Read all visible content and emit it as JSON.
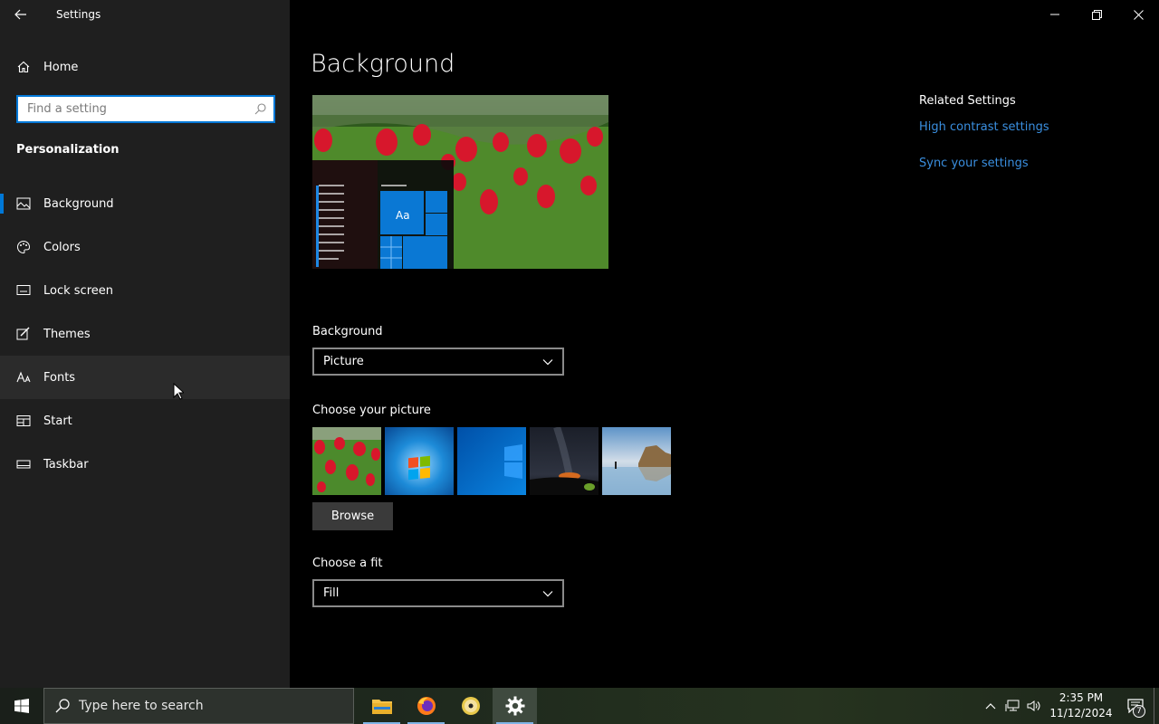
{
  "window": {
    "title": "Settings"
  },
  "sidebar": {
    "home_label": "Home",
    "search_placeholder": "Find a setting",
    "section_title": "Personalization",
    "items": [
      {
        "label": "Background",
        "icon": "picture-icon",
        "selected": true
      },
      {
        "label": "Colors",
        "icon": "palette-icon"
      },
      {
        "label": "Lock screen",
        "icon": "lock-screen-icon"
      },
      {
        "label": "Themes",
        "icon": "themes-brush-icon"
      },
      {
        "label": "Fonts",
        "icon": "fonts-icon",
        "hovered": true
      },
      {
        "label": "Start",
        "icon": "start-menu-icon"
      },
      {
        "label": "Taskbar",
        "icon": "taskbar-icon"
      }
    ]
  },
  "main": {
    "title": "Background",
    "preview_tile_text": "Aa",
    "background_label": "Background",
    "background_value": "Picture",
    "choose_picture_label": "Choose your picture",
    "thumbnails": [
      "tulips",
      "windows-7-logo",
      "windows-10-blue",
      "night-sky",
      "beach-rocks"
    ],
    "browse_label": "Browse",
    "fit_label": "Choose a fit",
    "fit_value": "Fill"
  },
  "related": {
    "title": "Related Settings",
    "links": [
      "High contrast settings",
      "Sync your settings"
    ]
  },
  "taskbar": {
    "search_placeholder": "Type here to search",
    "apps": [
      "file-explorer-icon",
      "firefox-icon",
      "media-disc-icon",
      "settings-gear-icon"
    ],
    "time": "2:35 PM",
    "date": "11/12/2024",
    "notification_count": "7"
  },
  "colors": {
    "accent": "#0078d7",
    "link": "#3a8fe0",
    "sidebar_bg": "#1f1f1f"
  }
}
